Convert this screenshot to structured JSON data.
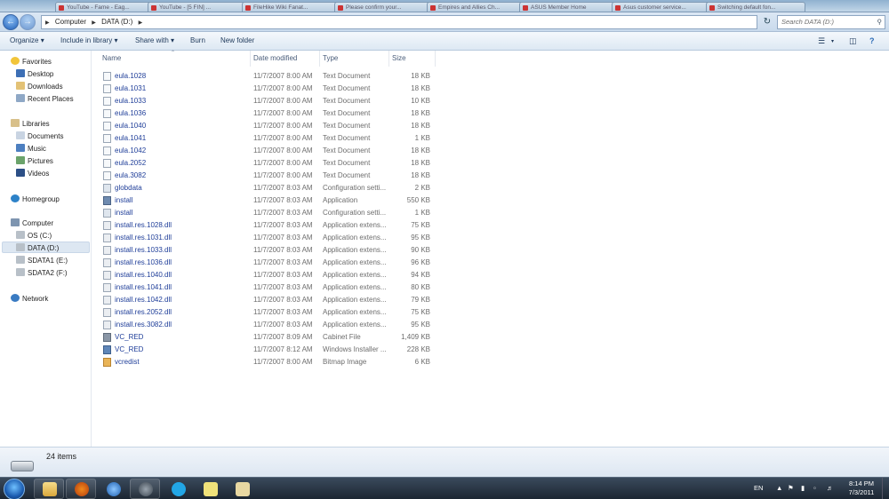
{
  "titlebar": {
    "tabs": [
      "YouTube - Fame - Eag...",
      "YouTube - [5 FIN] ...",
      "FileHike Wiki Fanat...",
      "Please confirm your...",
      "Empires and Allies Ch...",
      "ASUS Member Home",
      "Asus customer service...",
      "Switching default fon..."
    ]
  },
  "nav": {
    "address": [
      "Computer",
      "DATA (D:)"
    ],
    "search_placeholder": "Search DATA (D:)"
  },
  "toolbar": {
    "organize": "Organize",
    "include_in_library": "Include in library",
    "share_with": "Share with",
    "burn": "Burn",
    "new_folder": "New folder"
  },
  "sidebar": {
    "favorites": "Favorites",
    "desktop": "Desktop",
    "downloads": "Downloads",
    "recent_places": "Recent Places",
    "libraries": "Libraries",
    "documents": "Documents",
    "music": "Music",
    "pictures": "Pictures",
    "videos": "Videos",
    "homegroup": "Homegroup",
    "computer": "Computer",
    "os_c": "OS (C:)",
    "data_d": "DATA (D:)",
    "sdata1_e": "SDATA1 (E:)",
    "sdata2_f": "SDATA2 (F:)",
    "network": "Network"
  },
  "columns": {
    "name": "Name",
    "date": "Date modified",
    "type": "Type",
    "size": "Size"
  },
  "files": [
    {
      "name": "eula.1028",
      "date": "11/7/2007 8:00 AM",
      "type": "Text Document",
      "size": "18 KB"
    },
    {
      "name": "eula.1031",
      "date": "11/7/2007 8:00 AM",
      "type": "Text Document",
      "size": "18 KB"
    },
    {
      "name": "eula.1033",
      "date": "11/7/2007 8:00 AM",
      "type": "Text Document",
      "size": "10 KB"
    },
    {
      "name": "eula.1036",
      "date": "11/7/2007 8:00 AM",
      "type": "Text Document",
      "size": "18 KB"
    },
    {
      "name": "eula.1040",
      "date": "11/7/2007 8:00 AM",
      "type": "Text Document",
      "size": "18 KB"
    },
    {
      "name": "eula.1041",
      "date": "11/7/2007 8:00 AM",
      "type": "Text Document",
      "size": "1 KB"
    },
    {
      "name": "eula.1042",
      "date": "11/7/2007 8:00 AM",
      "type": "Text Document",
      "size": "18 KB"
    },
    {
      "name": "eula.2052",
      "date": "11/7/2007 8:00 AM",
      "type": "Text Document",
      "size": "18 KB"
    },
    {
      "name": "eula.3082",
      "date": "11/7/2007 8:00 AM",
      "type": "Text Document",
      "size": "18 KB"
    },
    {
      "name": "globdata",
      "date": "11/7/2007 8:03 AM",
      "type": "Configuration setti...",
      "size": "2 KB"
    },
    {
      "name": "install",
      "date": "11/7/2007 8:03 AM",
      "type": "Application",
      "size": "550 KB"
    },
    {
      "name": "install",
      "date": "11/7/2007 8:03 AM",
      "type": "Configuration setti...",
      "size": "1 KB"
    },
    {
      "name": "install.res.1028.dll",
      "date": "11/7/2007 8:03 AM",
      "type": "Application extens...",
      "size": "75 KB"
    },
    {
      "name": "install.res.1031.dll",
      "date": "11/7/2007 8:03 AM",
      "type": "Application extens...",
      "size": "95 KB"
    },
    {
      "name": "install.res.1033.dll",
      "date": "11/7/2007 8:03 AM",
      "type": "Application extens...",
      "size": "90 KB"
    },
    {
      "name": "install.res.1036.dll",
      "date": "11/7/2007 8:03 AM",
      "type": "Application extens...",
      "size": "96 KB"
    },
    {
      "name": "install.res.1040.dll",
      "date": "11/7/2007 8:03 AM",
      "type": "Application extens...",
      "size": "94 KB"
    },
    {
      "name": "install.res.1041.dll",
      "date": "11/7/2007 8:03 AM",
      "type": "Application extens...",
      "size": "80 KB"
    },
    {
      "name": "install.res.1042.dll",
      "date": "11/7/2007 8:03 AM",
      "type": "Application extens...",
      "size": "79 KB"
    },
    {
      "name": "install.res.2052.dll",
      "date": "11/7/2007 8:03 AM",
      "type": "Application extens...",
      "size": "75 KB"
    },
    {
      "name": "install.res.3082.dll",
      "date": "11/7/2007 8:03 AM",
      "type": "Application extens...",
      "size": "95 KB"
    },
    {
      "name": "VC_RED",
      "date": "11/7/2007 8:09 AM",
      "type": "Cabinet File",
      "size": "1,409 KB"
    },
    {
      "name": "VC_RED",
      "date": "11/7/2007 8:12 AM",
      "type": "Windows Installer ...",
      "size": "228 KB"
    },
    {
      "name": "vcredist",
      "date": "11/7/2007 8:00 AM",
      "type": "Bitmap Image",
      "size": "6 KB"
    }
  ],
  "status": {
    "item_count": "24 items"
  },
  "taskbar": {
    "lang": "EN",
    "time": "8:14 PM",
    "date": "7/3/2011"
  }
}
